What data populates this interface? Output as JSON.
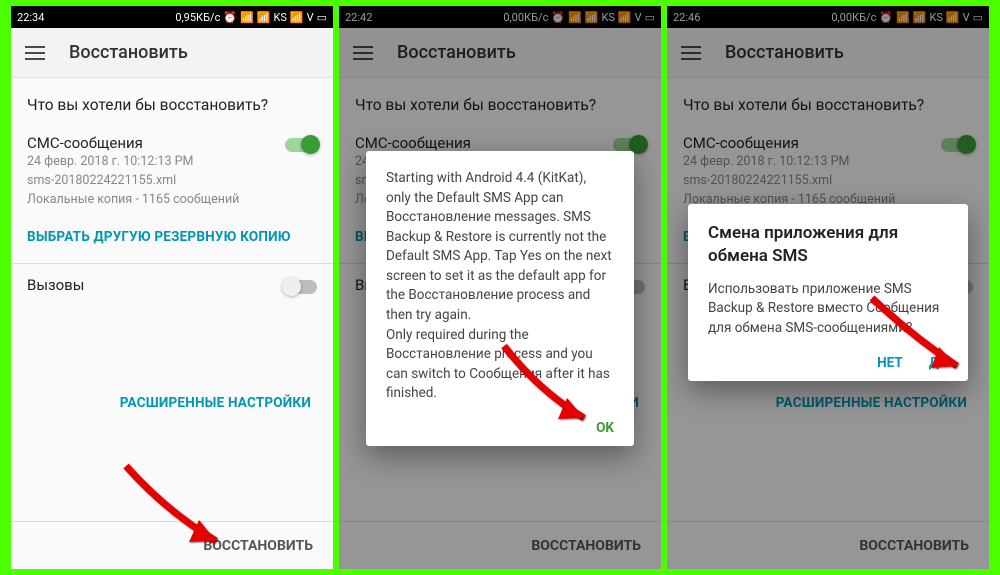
{
  "screens": [
    {
      "time": "22:34",
      "data": "0,95КБ/с"
    },
    {
      "time": "22:42",
      "data": "0,00КБ/с"
    },
    {
      "time": "22:46",
      "data": "0,00КБ/с"
    }
  ],
  "statusbar": {
    "carrier": "KS",
    "wifi": "▮",
    "alarm": "⏰",
    "battery": "▭",
    "v": "V"
  },
  "appbar": {
    "title": "Восстановить"
  },
  "page": {
    "question": "Что вы хотели бы восстановить?",
    "sms": {
      "title": "СМС-сообщения",
      "date": "24 февр. 2018 г. 10:12:13 PM",
      "file": "sms-20180224221155.xml",
      "local": "Локальные копия - 1165 сообщений"
    },
    "choose_backup": "ВЫБРАТЬ ДРУГУЮ РЕЗЕРВНУЮ КОПИЮ",
    "calls": {
      "title": "Вызовы"
    },
    "advanced": "РАСШИРЕННЫЕ НАСТРОЙКИ",
    "restore_btn": "ВОССТАНОВИТЬ"
  },
  "dialog1": {
    "body": "Starting with Android 4.4 (KitKat), only the Default SMS App can Восстановление messages. SMS Backup & Restore is currently not the Default SMS App. Tap Yes on the next screen to set it as the default app for the Восстановление process and then try again.\nOnly required during the Восстановление process and you can switch to Сообщения after it has finished.",
    "ok": "OK"
  },
  "dialog2": {
    "title": "Смена приложения для обмена SMS",
    "body": "Использовать приложение SMS Backup & Restore вместо Сообщения для обмена SMS-сообщениями?",
    "no": "НЕТ",
    "yes": "ДА"
  }
}
